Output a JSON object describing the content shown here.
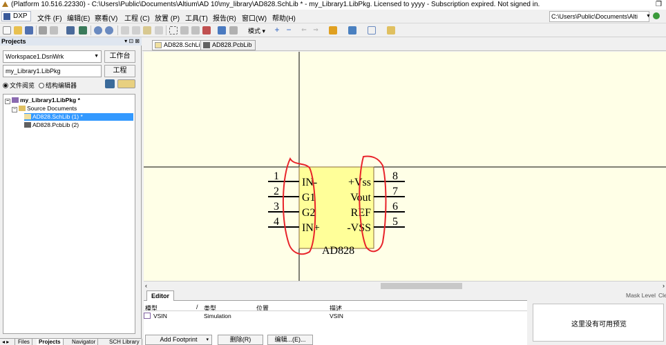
{
  "titlebar": {
    "text": "(Platform 10.516.22330) - C:\\Users\\Public\\Documents\\Altium\\AD 10\\my_library\\AD828.SchLib * - my_Library1.LibPkg. Licensed to yyyy - Subscription expired. Not signed in.",
    "restore": "❐"
  },
  "menubar": {
    "dxp": "DXP",
    "items": [
      "文件 (F)",
      "编辑(E)",
      "察看(V)",
      "工程 (C)",
      "放置 (P)",
      "工具(T)",
      "报告(R)",
      "窗口(W)",
      "帮助(H)"
    ],
    "path": "C:\\Users\\Public\\Documents\\Alti"
  },
  "toolbar": {
    "mode_label": "模式 ▾"
  },
  "projects_panel": {
    "title": "Projects",
    "controls": "▾ ⊡ ⊠",
    "workspace": "Workspace1.DsnWrk",
    "workspace_button": "工作台",
    "project": "my_Library1.LibPkg",
    "project_button": "工程",
    "radio_file_view": "文件阅览",
    "radio_structure": "结构编辑器",
    "tree": [
      {
        "label": "my_Library1.LibPkg *",
        "bold": true
      },
      {
        "label": "Source Documents",
        "bold": false
      },
      {
        "label": "AD828.SchLib (1) *",
        "bold": false,
        "selected": true
      },
      {
        "label": "AD828.PcbLib (2)",
        "bold": false
      }
    ],
    "bottom_tabs": [
      "Files",
      "Projects",
      "Navigator",
      "SCH Library"
    ],
    "bottom_arrows": "◂ ▸"
  },
  "doc_tabs": [
    "AD828.SchLib *",
    "AD828.PcbLib"
  ],
  "schematic": {
    "component": "AD828",
    "left_pins": [
      {
        "num": "1",
        "name": "IN-"
      },
      {
        "num": "2",
        "name": "G1"
      },
      {
        "num": "3",
        "name": "G2"
      },
      {
        "num": "4",
        "name": "IN+"
      }
    ],
    "right_pins": [
      {
        "num": "8",
        "name": "+Vss"
      },
      {
        "num": "7",
        "name": "Vout"
      },
      {
        "num": "6",
        "name": "REF"
      },
      {
        "num": "5",
        "name": "-VSS"
      }
    ],
    "body_color": "#ffff99",
    "annotation_color": "#e8232a"
  },
  "editor": {
    "tab": "Editor",
    "columns": [
      "模型",
      "/",
      "类型",
      "位置",
      "描述"
    ],
    "row": {
      "model": "VSIN",
      "type": "Simulation",
      "location": "",
      "description": "VSIN"
    },
    "buttons": {
      "add_footprint": "Add Footprint",
      "add_arrow": "▾",
      "delete": "删除(R)",
      "edit": "编辑...(E)..."
    }
  },
  "right_strip": {
    "mask_level": "Mask Level",
    "clear": "Cle",
    "preview_text": "这里没有可用预览"
  },
  "scroll": {
    "left": "‹",
    "right": "›"
  }
}
